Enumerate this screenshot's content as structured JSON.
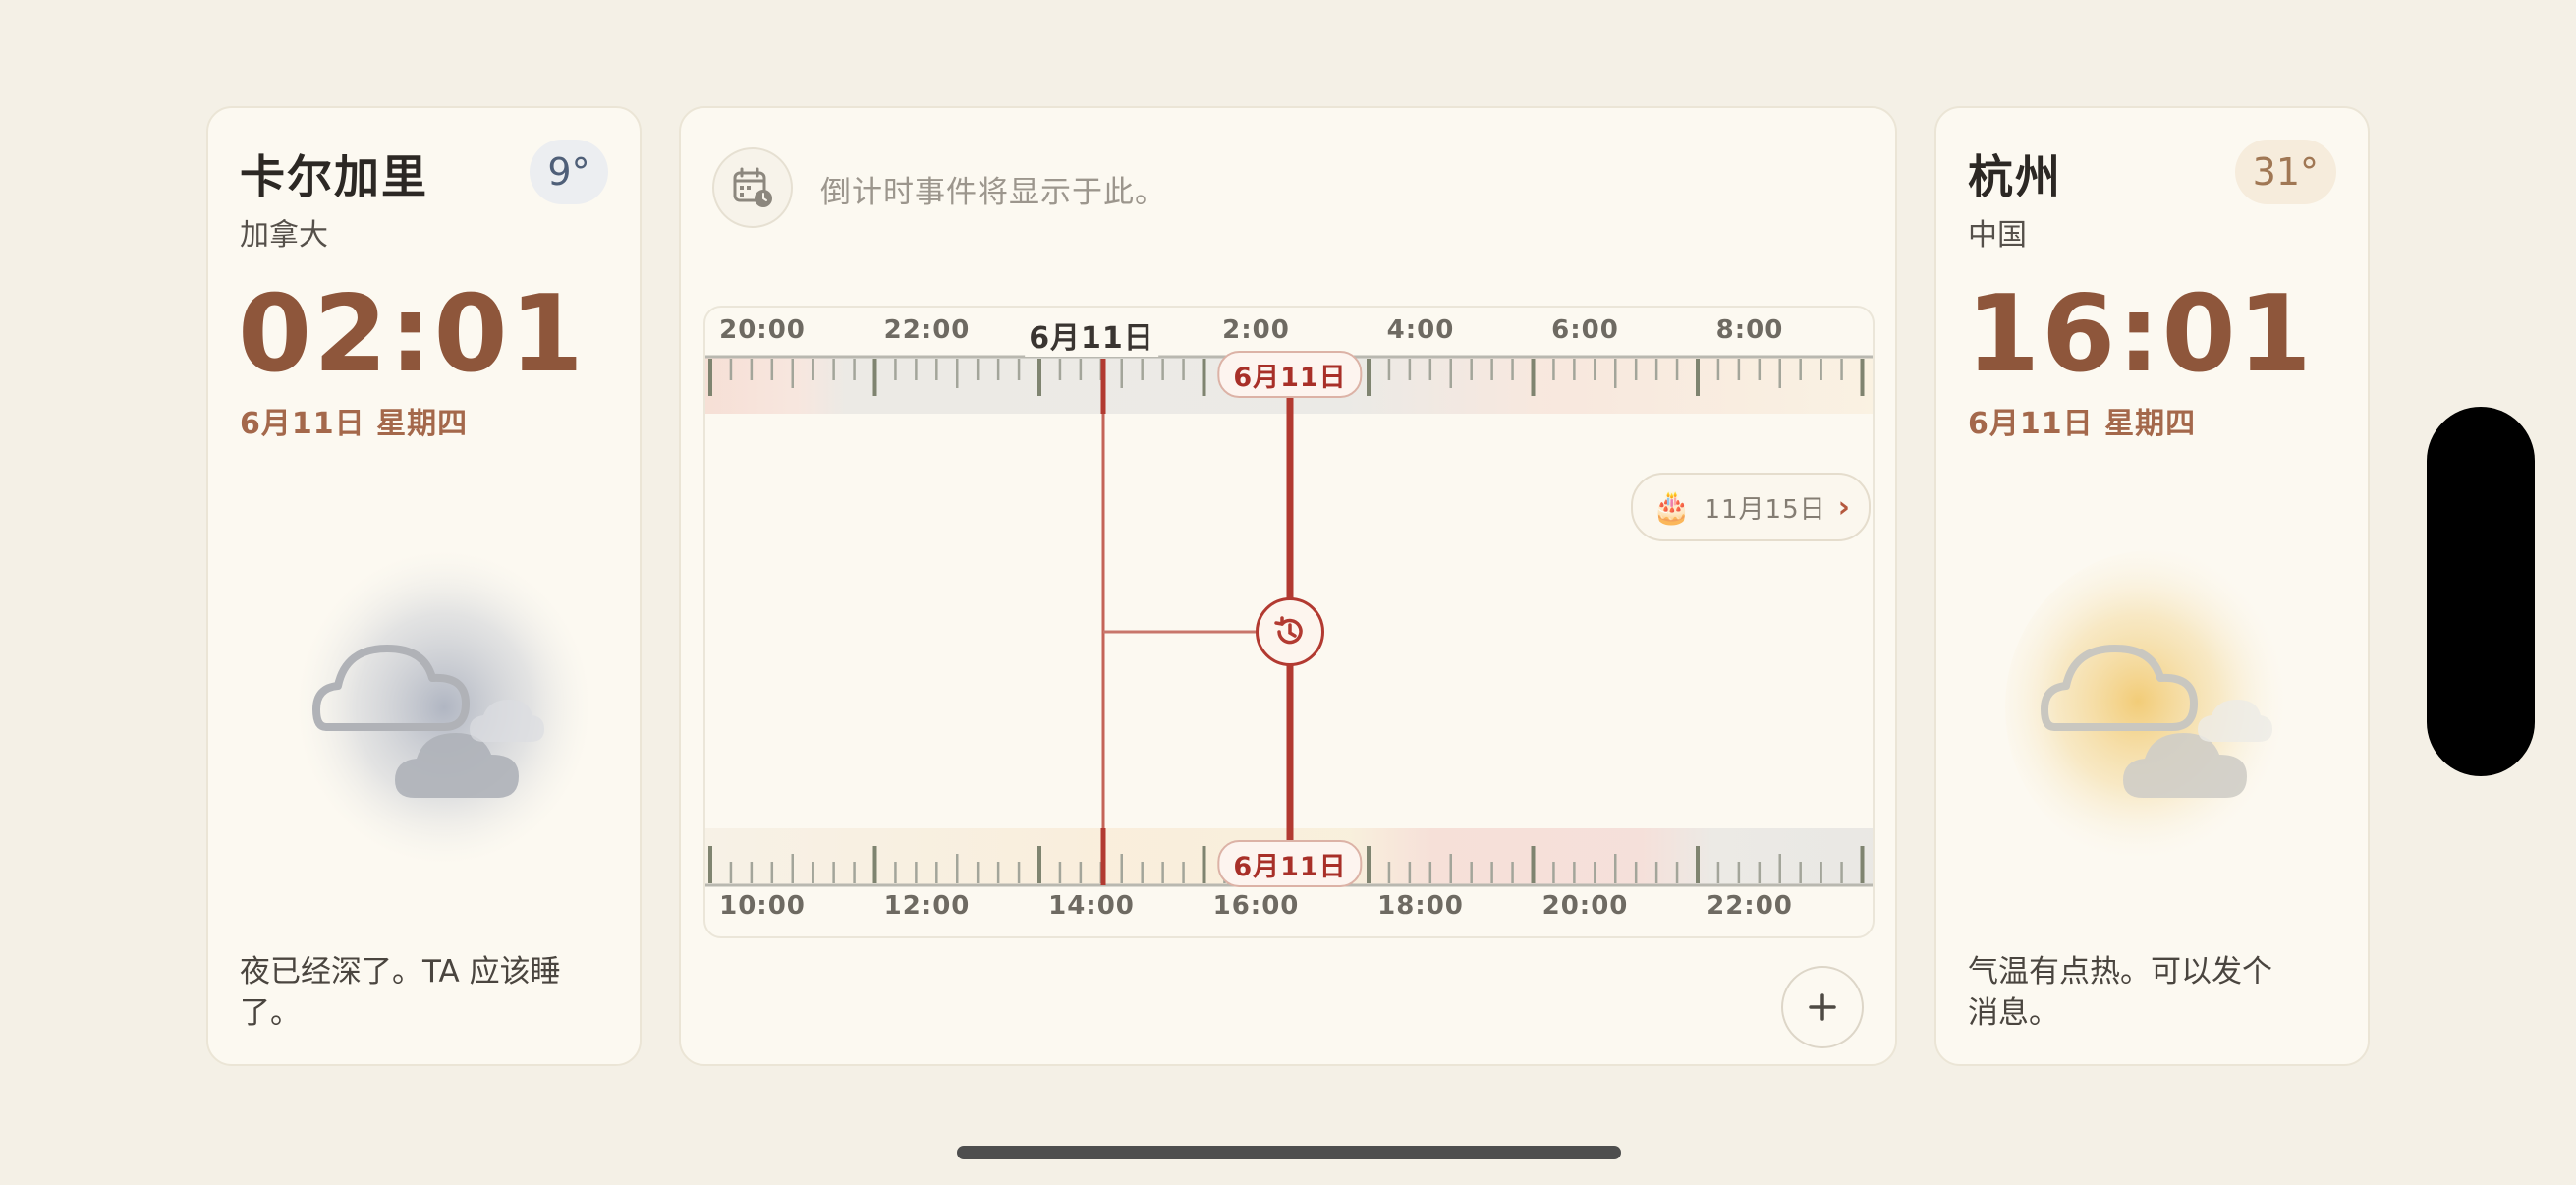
{
  "left_city": {
    "name": "卡尔加里",
    "country": "加拿大",
    "temperature": "9°",
    "time": "02:01",
    "date": "6月11日 星期四",
    "weather_icon": "cloudy-night-icon",
    "message": "夜已经深了。TA 应该睡了。"
  },
  "right_city": {
    "name": "杭州",
    "country": "中国",
    "temperature": "31°",
    "time": "16:01",
    "date": "6月11日 星期四",
    "weather_icon": "partly-cloudy-sunny-icon",
    "message": "气温有点热。可以发个消息。"
  },
  "countdown": {
    "placeholder": "倒计时事件将显示于此。",
    "icon": "calendar-clock-icon"
  },
  "timeline": {
    "top_hours": [
      "20:00",
      "22:00",
      "6月11日",
      "2:00",
      "4:00",
      "6:00",
      "8:00"
    ],
    "bottom_hours": [
      "10:00",
      "12:00",
      "14:00",
      "16:00",
      "18:00",
      "20:00",
      "22:00"
    ],
    "now_top_label": "6月11日",
    "now_bottom_label": "6月11日",
    "event": {
      "icon": "birthday-cake-icon",
      "emoji": "🎂",
      "label": "11月15日"
    },
    "history_icon": "history-icon"
  },
  "add_button_icon": "plus-icon",
  "colors": {
    "accent": "#b23a31",
    "time_brown": "#8e563b",
    "background": "#f4f0e6",
    "card": "#fcf9f1"
  }
}
